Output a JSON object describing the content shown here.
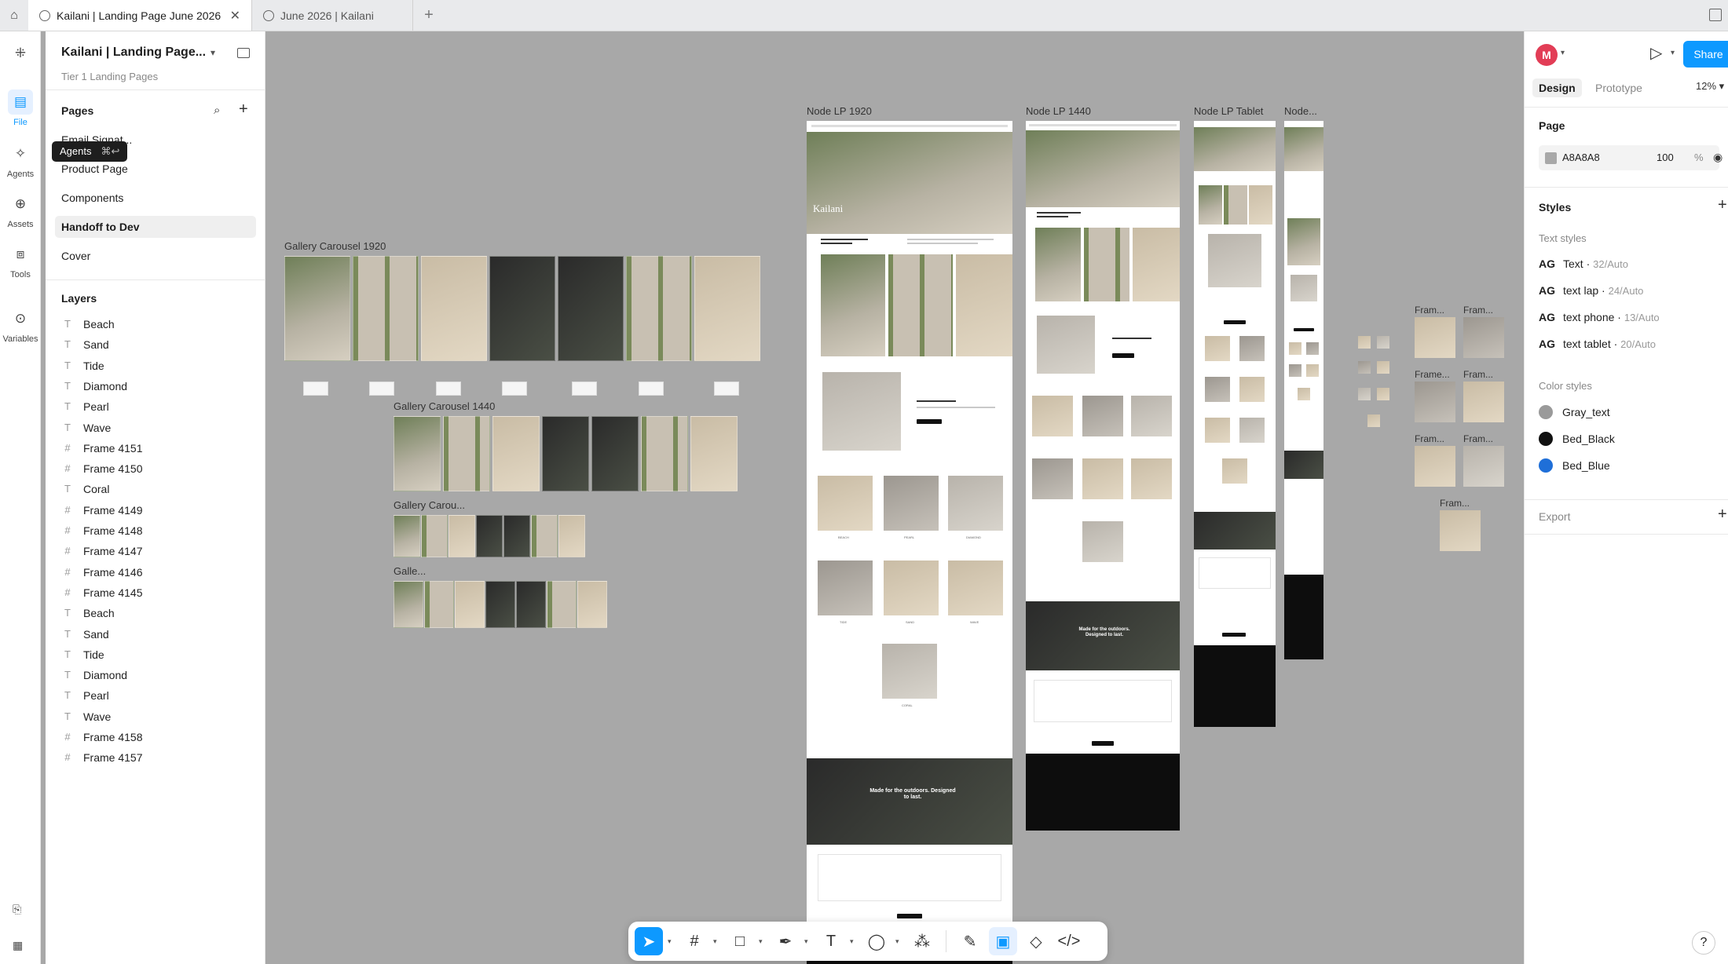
{
  "tabs": [
    {
      "label": "Kailani | Landing Page June 2026",
      "active": true
    },
    {
      "label": "June 2026 | Kailani",
      "active": false
    }
  ],
  "rail": [
    {
      "label": "File",
      "icon": "file-icon"
    },
    {
      "label": "Agents",
      "icon": "agents-icon"
    },
    {
      "label": "Assets",
      "icon": "assets-icon"
    },
    {
      "label": "Tools",
      "icon": "tools-icon"
    },
    {
      "label": "Variables",
      "icon": "variables-icon"
    }
  ],
  "file": {
    "title": "Kailani | Landing Page...",
    "subtitle": "Tier 1 Landing Pages"
  },
  "tooltip": {
    "label": "Agents",
    "shortcut": "⌘↩"
  },
  "pages": {
    "heading": "Pages",
    "items": [
      "Email Signat...",
      "Product Page",
      "Components",
      "Handoff to Dev",
      "Cover"
    ],
    "selected": "Handoff to Dev"
  },
  "layers": {
    "heading": "Layers",
    "items": [
      {
        "name": "Beach",
        "type": "text"
      },
      {
        "name": "Sand",
        "type": "text"
      },
      {
        "name": "Tide",
        "type": "text"
      },
      {
        "name": "Diamond",
        "type": "text"
      },
      {
        "name": "Pearl",
        "type": "text"
      },
      {
        "name": "Wave",
        "type": "text"
      },
      {
        "name": "Frame 4151",
        "type": "frame"
      },
      {
        "name": "Frame 4150",
        "type": "frame"
      },
      {
        "name": "Coral",
        "type": "text"
      },
      {
        "name": "Frame 4149",
        "type": "frame"
      },
      {
        "name": "Frame 4148",
        "type": "frame"
      },
      {
        "name": "Frame 4147",
        "type": "frame"
      },
      {
        "name": "Frame 4146",
        "type": "frame"
      },
      {
        "name": "Frame 4145",
        "type": "frame"
      },
      {
        "name": "Beach",
        "type": "text"
      },
      {
        "name": "Sand",
        "type": "text"
      },
      {
        "name": "Tide",
        "type": "text"
      },
      {
        "name": "Diamond",
        "type": "text"
      },
      {
        "name": "Pearl",
        "type": "text"
      },
      {
        "name": "Wave",
        "type": "text"
      },
      {
        "name": "Frame 4158",
        "type": "frame"
      },
      {
        "name": "Frame 4157",
        "type": "frame"
      }
    ]
  },
  "canvas": {
    "frames": {
      "gallery1920": "Gallery Carousel 1920",
      "gallery1440": "Gallery Carousel 1440",
      "galleryTab": "Gallery Carou...",
      "galleryPhone": "Galle...",
      "lp1920": "Node LP 1920",
      "lp1440": "Node LP 1440",
      "lpTablet": "Node LP Tablet",
      "lpPhone": "Node...",
      "fram1": "Fram...",
      "fram2": "Fram...",
      "fram3": "Frame...",
      "fram4": "Fram...",
      "fram5": "Fram...",
      "fram6": "Fram...",
      "fram7": "Fram..."
    },
    "lp1920_texts": {
      "hero": "Kailani",
      "cta": "Made for the outdoors. Designed to last."
    },
    "lp1440_texts": {
      "cta": "Made for the outdoors. Designed to last."
    },
    "tile_names": [
      "BEACH",
      "PEARL",
      "DIAMOND",
      "TIDE",
      "SAND",
      "WAVE",
      "CORAL"
    ]
  },
  "design": {
    "avatar": "M",
    "share": "Share",
    "tabs": [
      "Design",
      "Prototype"
    ],
    "zoom": "12%",
    "page_heading": "Page",
    "page_color": "A8A8A8",
    "page_opacity": "100",
    "pct": "%",
    "styles_heading": "Styles",
    "text_styles_heading": "Text styles",
    "text_styles": [
      {
        "name": "Text",
        "meta": "32/Auto"
      },
      {
        "name": "text lap",
        "meta": "24/Auto"
      },
      {
        "name": "text phone",
        "meta": "13/Auto"
      },
      {
        "name": "text tablet",
        "meta": "20/Auto"
      }
    ],
    "color_styles_heading": "Color styles",
    "color_styles": [
      {
        "name": "Gray_text",
        "color": "#9a9a9a"
      },
      {
        "name": "Bed_Black",
        "color": "#111111"
      },
      {
        "name": "Bed_Blue",
        "color": "#1f6fd8"
      }
    ],
    "export_heading": "Export"
  },
  "colors": {
    "accent": "#0d99ff",
    "canvas": "#A8A8A8"
  }
}
